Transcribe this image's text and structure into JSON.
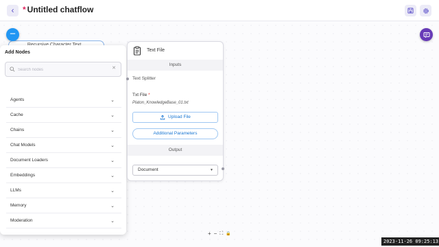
{
  "header": {
    "back_icon": "chevron-left-icon",
    "unsaved_marker": "*",
    "title": "Untitled chatflow",
    "save_icon": "save-icon",
    "settings_icon": "gear-icon"
  },
  "canvas": {
    "collapse_icon": "minus-icon",
    "chat_icon": "chat-icon",
    "hidden_node_label": "Recursive Character Text..."
  },
  "add_nodes": {
    "title": "Add Nodes",
    "search_placeholder": "Search nodes",
    "search_value": "",
    "clear_icon": "close-icon",
    "categories": [
      {
        "label": "Agents"
      },
      {
        "label": "Cache"
      },
      {
        "label": "Chains"
      },
      {
        "label": "Chat Models"
      },
      {
        "label": "Document Loaders"
      },
      {
        "label": "Embeddings"
      },
      {
        "label": "LLMs"
      },
      {
        "label": "Memory"
      },
      {
        "label": "Moderation"
      }
    ]
  },
  "node": {
    "title": "Text File",
    "inputs_label": "Inputs",
    "text_splitter_label": "Text Splitter",
    "txt_file_label": "Txt File",
    "required_marker": "*",
    "file_name": "Platon_KnowledgeBase_01.txt",
    "upload_button": "Upload File",
    "additional_params_button": "Additional Parameters",
    "output_label": "Output",
    "output_select": "Document"
  },
  "controls": {
    "zoom_in": "+",
    "zoom_out": "−",
    "fit_view": "⛶",
    "lock": "🔒"
  },
  "timestamp": "2023-11-26  09:25:13",
  "colors": {
    "accent": "#2196f3",
    "chat_button": "#673ab7",
    "required": "#e53935"
  }
}
